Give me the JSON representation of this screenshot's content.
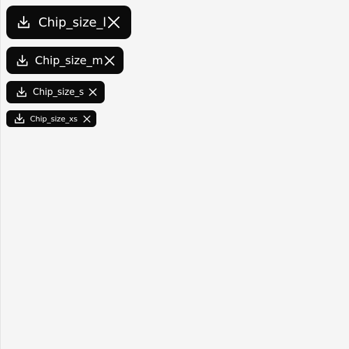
{
  "theme": {
    "background": "#f5f5f5",
    "chip_background": "#0b0b0b",
    "chip_text": "#ffffff"
  },
  "chips": [
    {
      "size": "l",
      "label": "Chip_size_l",
      "leading_icon": "download-icon",
      "trailing_icon": "close-icon"
    },
    {
      "size": "m",
      "label": "Chip_size_m",
      "leading_icon": "download-icon",
      "trailing_icon": "close-icon"
    },
    {
      "size": "s",
      "label": "Chip_size_s",
      "leading_icon": "download-icon",
      "trailing_icon": "close-icon"
    },
    {
      "size": "xs",
      "label": "Chip_size_xs",
      "leading_icon": "download-icon",
      "trailing_icon": "close-icon"
    }
  ]
}
